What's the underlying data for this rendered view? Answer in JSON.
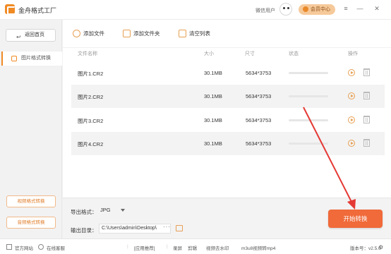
{
  "app": {
    "title": "金舟格式工厂"
  },
  "header": {
    "user_name": "微信用户",
    "vip_label": "会员中心",
    "controls": [
      "≡",
      "—",
      "✕"
    ]
  },
  "sidebar": {
    "back_label": "返回首页",
    "active_item": "图片格式转换",
    "bottom_buttons": [
      "视频格式转换",
      "音频格式转换"
    ]
  },
  "toolbar": {
    "add_file": "添加文件",
    "add_folder": "添加文件夹",
    "clear_list": "清空列表"
  },
  "table": {
    "headers": {
      "name": "文件名称",
      "size": "大小",
      "dimensions": "尺寸",
      "status": "状态",
      "ops": "操作"
    },
    "rows": [
      {
        "name": "图片1.CR2",
        "size": "30.1MB",
        "dimensions": "5634*3753",
        "progress": 0
      },
      {
        "name": "图片2.CR2",
        "size": "30.1MB",
        "dimensions": "5634*3753",
        "progress": 0
      },
      {
        "name": "图片3.CR2",
        "size": "30.1MB",
        "dimensions": "5634*3753",
        "progress": 0
      },
      {
        "name": "图片4.CR2",
        "size": "30.1MB",
        "dimensions": "5634*3753",
        "progress": 0
      }
    ]
  },
  "settings": {
    "format_label": "导出格式：",
    "format_value": "JPG",
    "dir_label": "输出目录：",
    "dir_value": "C:\\Users\\admin\\Desktop\\",
    "more_label": "···",
    "start_label": "开始转换"
  },
  "footer": {
    "home": "官方网站",
    "service": "在线客服",
    "sep": "|",
    "recommend": "[应用推荐]",
    "links": [
      "录屏",
      "剪辑",
      "视频去水印",
      "m3u8视频转mp4"
    ],
    "version": "版本号：v2.5.0",
    "settings_icon": "⚙"
  },
  "colors": {
    "accent": "#f08a24",
    "start_button": "#f06a3a",
    "annotation_arrow": "#e53935"
  }
}
